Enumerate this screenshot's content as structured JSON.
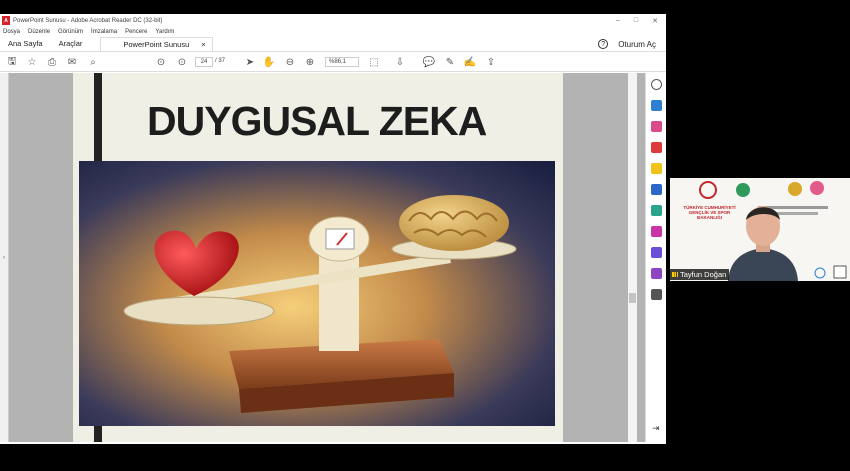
{
  "window": {
    "title": "PowerPoint Sunusu - Adobe Acrobat Reader DC (32-bit)",
    "app_logo": "A"
  },
  "menu": [
    "Dosya",
    "Düzenle",
    "Görünüm",
    "İmzalama",
    "Pencere",
    "Yardım"
  ],
  "tabs": {
    "home": "Ana Sayfa",
    "tools": "Araçlar",
    "document": "PowerPoint Sunusu",
    "close": "×",
    "help": "?",
    "signin": "Oturum Aç"
  },
  "toolbar": {
    "current_page": "24",
    "total_pages": "/ 37",
    "zoom": "%86,1"
  },
  "slide": {
    "title": "DUYGUSAL ZEKA"
  },
  "video": {
    "participant_name": "Tayfun Doğan",
    "ministry_text": "TÜRKİYE CUMHURİYETİ GENÇLİK VE SPOR BAKANLIĞI"
  },
  "colors": {
    "accent_red": "#d3222a",
    "page_bg": "#efefe6",
    "doc_gray": "#b3b3b3"
  }
}
